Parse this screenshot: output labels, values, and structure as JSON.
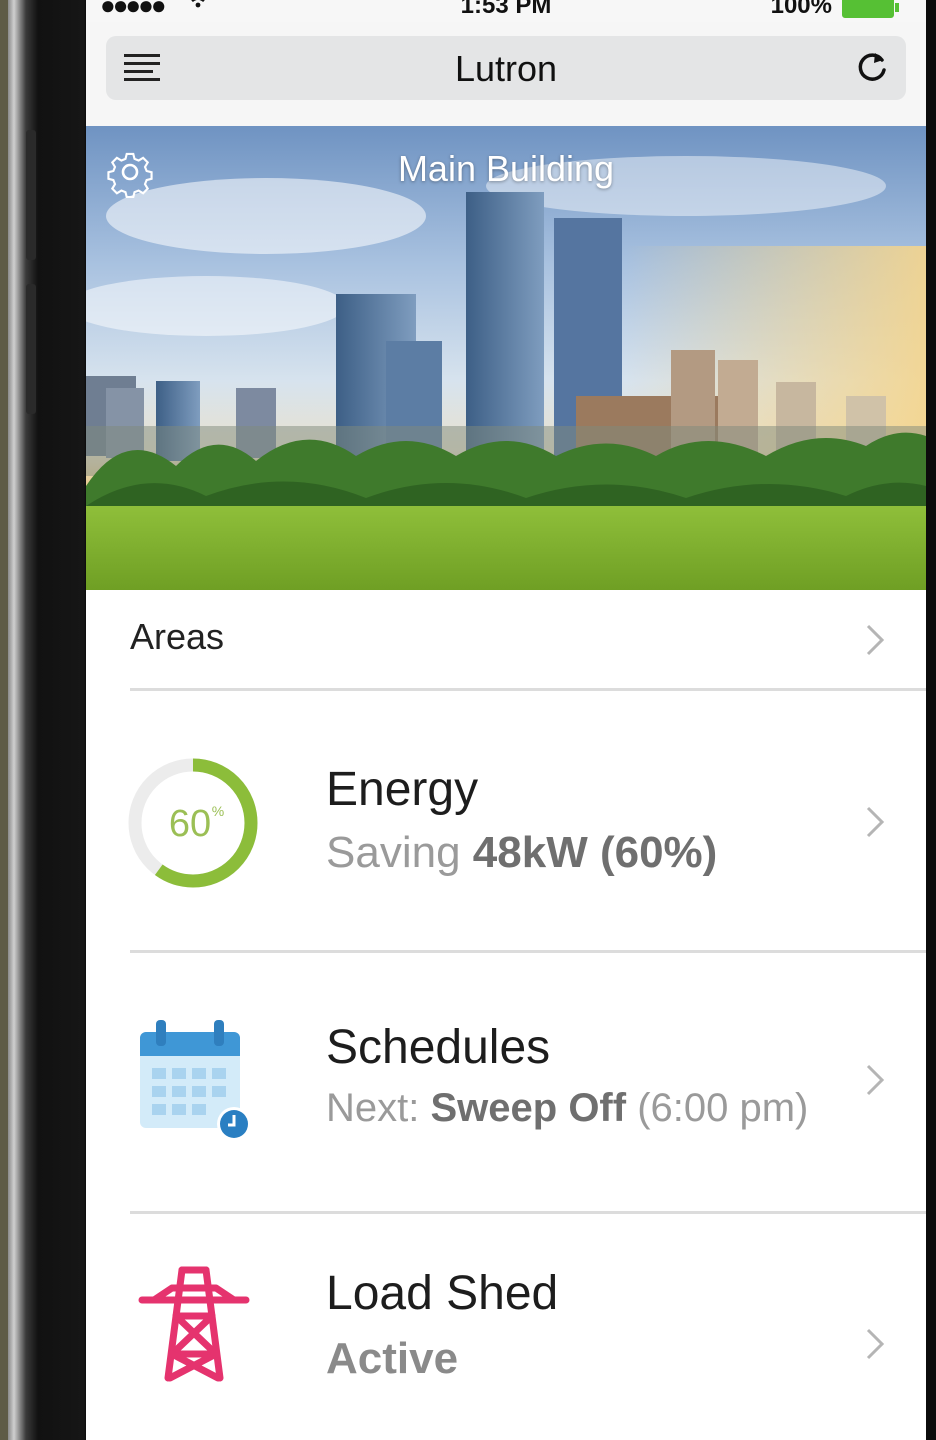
{
  "status_bar": {
    "signal": "●●●●●",
    "time": "1:53 PM",
    "battery_pct": "100%",
    "battery_color": "#56c034"
  },
  "nav": {
    "title": "Lutron",
    "left_icon": "menu-icon",
    "right_icon": "refresh-icon"
  },
  "hero": {
    "title": "Main Building",
    "settings_icon": "gear-icon"
  },
  "list": {
    "areas": {
      "label": "Areas"
    },
    "energy": {
      "title": "Energy",
      "sub_prefix": "Saving",
      "sub_value": "48kW (60%)",
      "ring_label": "60",
      "ring_unit": "%",
      "ring_fraction": 0.6,
      "ring_color": "#8cbd3a"
    },
    "schedules": {
      "title": "Schedules",
      "sub_prefix": "Next:",
      "sub_event": "Sweep Off",
      "sub_time": "(6:00 pm)",
      "icon": "calendar-icon",
      "icon_color": "#3f97d6"
    },
    "load_shed": {
      "title": "Load Shed",
      "status": "Active",
      "icon": "power-tower-icon",
      "icon_color": "#e5336e"
    }
  }
}
